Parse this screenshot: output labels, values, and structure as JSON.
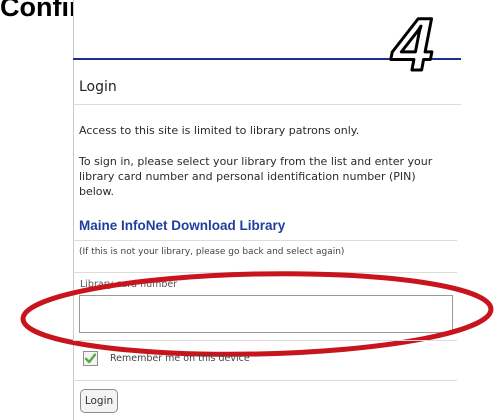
{
  "step": {
    "heading": "Confirm check out.",
    "number": "4"
  },
  "login": {
    "title": "Login",
    "access_notice": "Access to this site is limited to library patrons only.",
    "instructions": "To sign in, please select your library from the list and enter your library card number and personal identification number (PIN) below.",
    "library_name": "Maine InfoNet Download Library",
    "not_your_library_note": "(If this is not your library, please go back and select again)",
    "card_number_label": "Library card number",
    "card_number_value": "",
    "remember_checked": true,
    "remember_label": "Remember me on this device",
    "login_button_label": "Login"
  },
  "colors": {
    "accent_rule": "#1d2f8c",
    "library_link": "#1f3f9c",
    "highlight_ellipse": "#c8141c",
    "checkbox_mark": "#5aa83a"
  },
  "icons": {
    "checkbox": "checkmark-icon"
  }
}
